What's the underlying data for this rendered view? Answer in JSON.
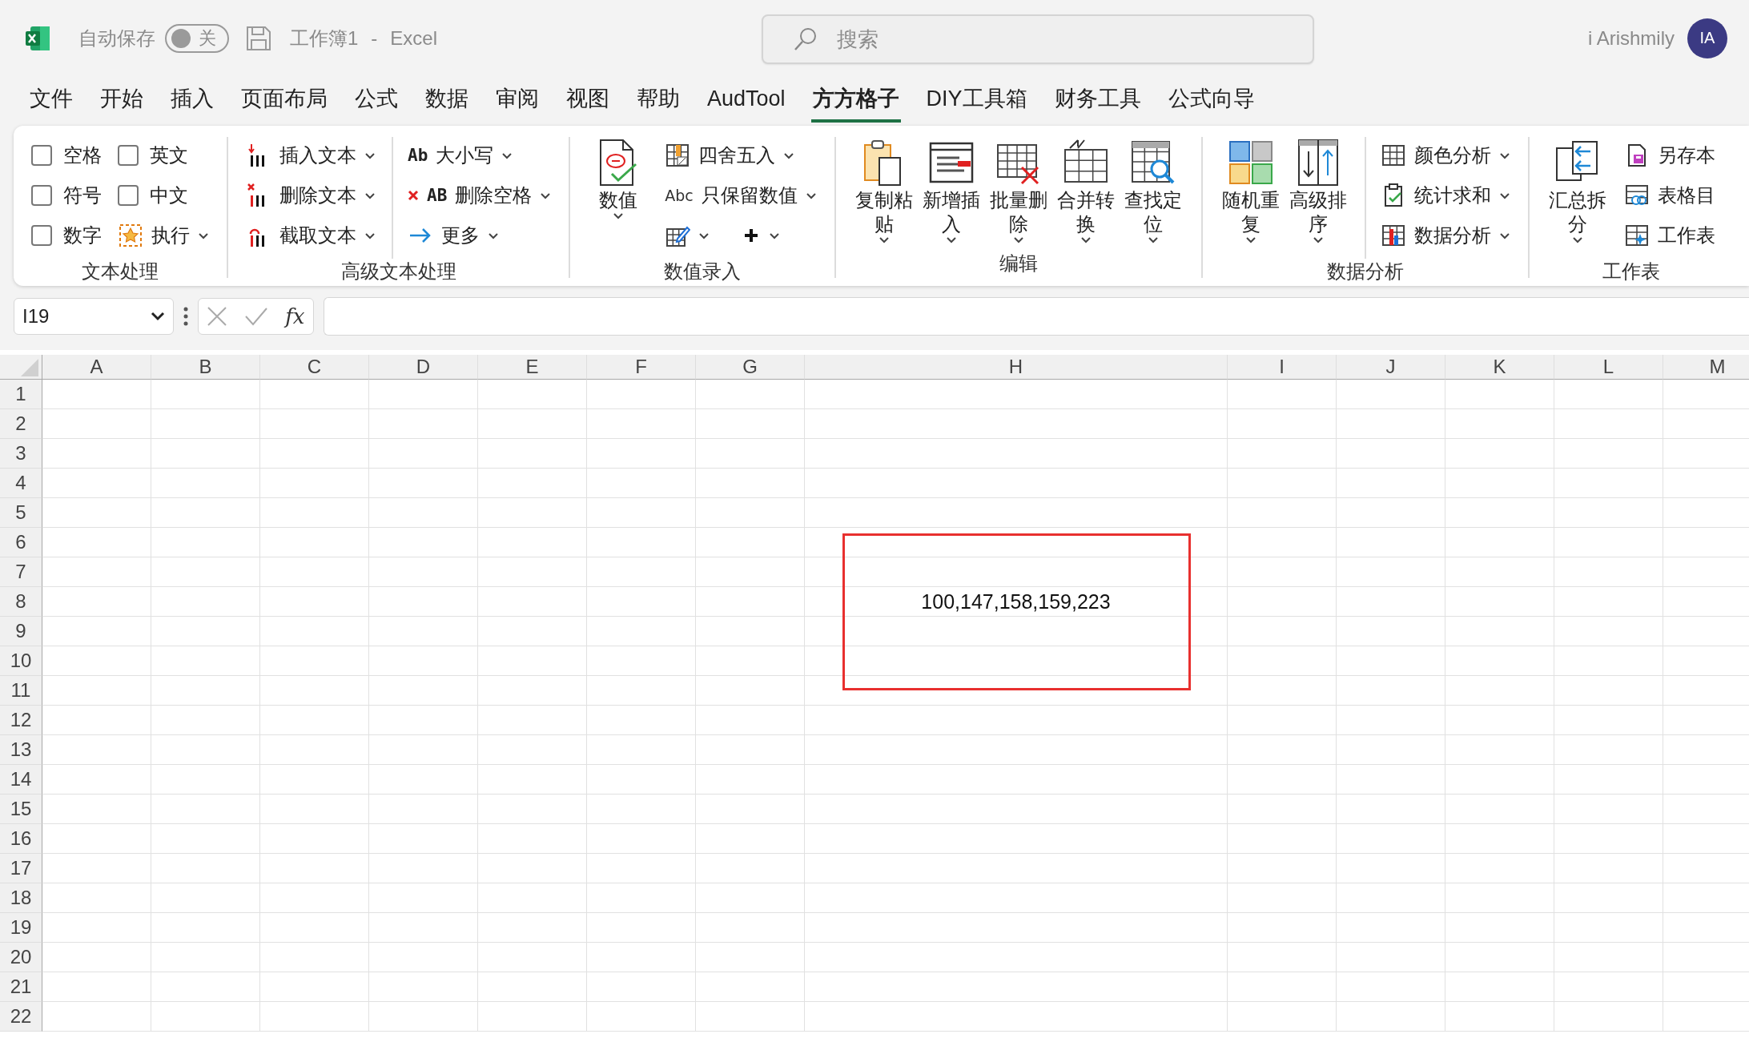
{
  "title_bar": {
    "autosave_label": "自动保存",
    "autosave_toggle": {
      "on": false,
      "label": "关"
    },
    "document_title": "工作簿1",
    "separator": "-",
    "app_name": "Excel",
    "search_placeholder": "搜索",
    "user_name": "i Arishmily",
    "avatar_initials": "IA"
  },
  "menu_tabs": [
    {
      "label": "文件",
      "selected": false
    },
    {
      "label": "开始",
      "selected": false
    },
    {
      "label": "插入",
      "selected": false
    },
    {
      "label": "页面布局",
      "selected": false
    },
    {
      "label": "公式",
      "selected": false
    },
    {
      "label": "数据",
      "selected": false
    },
    {
      "label": "审阅",
      "selected": false
    },
    {
      "label": "视图",
      "selected": false
    },
    {
      "label": "帮助",
      "selected": false
    },
    {
      "label": "AudTool",
      "selected": false
    },
    {
      "label": "方方格子",
      "selected": true
    },
    {
      "label": "DIY工具箱",
      "selected": false
    },
    {
      "label": "财务工具",
      "selected": false
    },
    {
      "label": "公式向导",
      "selected": false
    }
  ],
  "ribbon_groups": [
    {
      "label": "文本处理",
      "columns": [
        {
          "divided": false,
          "items": [
            {
              "kind": "checkbox",
              "label": "空格",
              "checked": false
            },
            {
              "kind": "checkbox",
              "label": "符号",
              "checked": false
            },
            {
              "kind": "checkbox",
              "label": "数字",
              "checked": false
            }
          ]
        },
        {
          "divided": false,
          "items": [
            {
              "kind": "checkbox",
              "label": "英文",
              "checked": false
            },
            {
              "kind": "checkbox",
              "label": "中文",
              "checked": false
            },
            {
              "kind": "small",
              "label": "执行",
              "dropdown": true
            }
          ]
        }
      ]
    },
    {
      "label": "高级文本处理",
      "columns": [
        {
          "divided": false,
          "items": [
            {
              "kind": "small",
              "label": "插入文本",
              "dropdown": true
            },
            {
              "kind": "small",
              "label": "删除文本",
              "dropdown": true
            },
            {
              "kind": "small",
              "label": "截取文本",
              "dropdown": true
            }
          ]
        },
        {
          "divided": true,
          "items": [
            {
              "kind": "small",
              "icon_text": "Ab",
              "label": "大小写",
              "dropdown": true
            },
            {
              "kind": "small",
              "icon_text": "AB",
              "label": "删除空格",
              "dropdown": true
            },
            {
              "kind": "small",
              "label": "更多",
              "dropdown": true
            }
          ]
        }
      ]
    },
    {
      "label": "数值录入",
      "columns": [
        {
          "divided": false,
          "items": [
            {
              "kind": "large",
              "label": "数值",
              "dropdown": true
            }
          ]
        },
        {
          "divided": false,
          "items": [
            {
              "kind": "small",
              "label": "四舍五入",
              "dropdown": true
            },
            {
              "kind": "small",
              "icon_text": "Abc",
              "label": "只保留数值",
              "dropdown": true
            },
            {
              "kind": "icon_row",
              "buttons": [
                {
                  "dropdown": true
                },
                {
                  "dropdown": true
                }
              ]
            }
          ]
        }
      ]
    },
    {
      "label": "编辑",
      "columns": [
        {
          "divided": false,
          "items": [
            {
              "kind": "large",
              "label": "复制粘贴",
              "dropdown": true
            },
            {
              "kind": "large",
              "label": "新增插入",
              "dropdown": true
            },
            {
              "kind": "large",
              "label": "批量删除",
              "dropdown": true
            },
            {
              "kind": "large",
              "label": "合并转换",
              "dropdown": true
            },
            {
              "kind": "large",
              "label": "查找定位",
              "dropdown": true
            }
          ]
        }
      ]
    },
    {
      "label": "数据分析",
      "columns": [
        {
          "divided": false,
          "items": [
            {
              "kind": "large",
              "label": "随机重复",
              "dropdown": true
            },
            {
              "kind": "large",
              "label": "高级排序",
              "dropdown": true
            }
          ]
        },
        {
          "divided": true,
          "items": [
            {
              "kind": "small",
              "label": "颜色分析",
              "dropdown": true
            },
            {
              "kind": "small",
              "label": "统计求和",
              "dropdown": true
            },
            {
              "kind": "small",
              "label": "数据分析",
              "dropdown": true
            }
          ]
        }
      ]
    },
    {
      "label": "工作表",
      "columns": [
        {
          "divided": false,
          "items": [
            {
              "kind": "large",
              "label": "汇总拆分",
              "dropdown": true
            }
          ]
        },
        {
          "divided": false,
          "items": [
            {
              "kind": "small",
              "label": "另存本",
              "dropdown": false
            },
            {
              "kind": "small",
              "label": "表格目",
              "dropdown": false
            },
            {
              "kind": "small",
              "label": "工作表",
              "dropdown": false
            }
          ]
        }
      ]
    }
  ],
  "formula_bar": {
    "name_box": "I19",
    "function_label": "fx"
  },
  "sheet": {
    "columns": [
      {
        "label": "A"
      },
      {
        "label": "B"
      },
      {
        "label": "C"
      },
      {
        "label": "D"
      },
      {
        "label": "E"
      },
      {
        "label": "F"
      },
      {
        "label": "G"
      },
      {
        "label": "H"
      },
      {
        "label": "I"
      },
      {
        "label": "J"
      },
      {
        "label": "K"
      },
      {
        "label": "L"
      },
      {
        "label": "M"
      }
    ],
    "rows": [
      {
        "label": "1"
      },
      {
        "label": "2"
      },
      {
        "label": "3"
      },
      {
        "label": "4"
      },
      {
        "label": "5"
      },
      {
        "label": "6"
      },
      {
        "label": "7"
      },
      {
        "label": "8",
        "cells": [
          null,
          null,
          null,
          null,
          null,
          null,
          null,
          "100,147,158,159,223"
        ]
      },
      {
        "label": "9"
      },
      {
        "label": "10"
      },
      {
        "label": "11"
      },
      {
        "label": "12"
      },
      {
        "label": "13"
      },
      {
        "label": "14"
      },
      {
        "label": "15"
      },
      {
        "label": "16"
      },
      {
        "label": "17"
      },
      {
        "label": "18"
      },
      {
        "label": "19"
      },
      {
        "label": "20"
      },
      {
        "label": "21"
      },
      {
        "label": "22"
      }
    ],
    "overlay_shapes": [
      {
        "kind": "rectangle"
      }
    ]
  }
}
